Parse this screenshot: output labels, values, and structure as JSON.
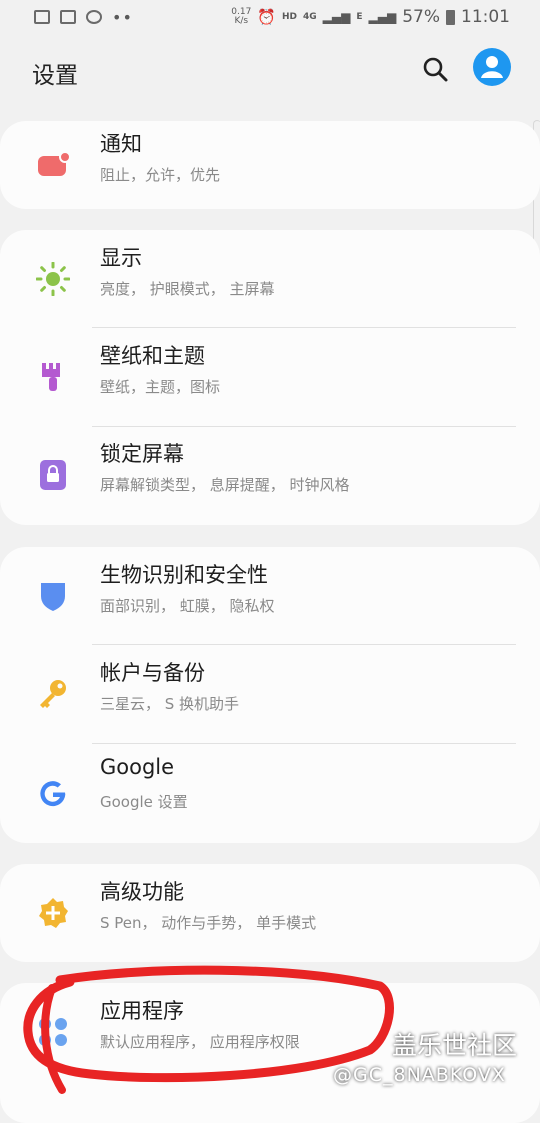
{
  "status_bar": {
    "net_speed_value": "0.17",
    "net_speed_unit": "K/s",
    "hd": "HD",
    "net_4g": "4G",
    "net_e": "E",
    "battery": "57%",
    "time": "11:01"
  },
  "header": {
    "title": "设置"
  },
  "groups": [
    {
      "items": [
        {
          "label": "通知",
          "sub": "阻止，允许，优先",
          "icon": "notification-icon",
          "color": "#ef6b6b"
        }
      ]
    },
    {
      "items": [
        {
          "label": "显示",
          "sub": "亮度， 护眼模式， 主屏幕",
          "icon": "sun-icon",
          "color": "#8cc34a"
        },
        {
          "label": "壁纸和主题",
          "sub": "壁纸，主题，图标",
          "icon": "paintbrush-icon",
          "color": "#b45ad0"
        },
        {
          "label": "锁定屏幕",
          "sub": "屏幕解锁类型， 息屏提醒， 时钟风格",
          "icon": "lock-icon",
          "color": "#9c6fde"
        }
      ]
    },
    {
      "items": [
        {
          "label": "生物识别和安全性",
          "sub": "面部识别， 虹膜， 隐私权",
          "icon": "shield-icon",
          "color": "#5a8ef0"
        },
        {
          "label": "帐户与备份",
          "sub": "三星云， S 换机助手",
          "icon": "key-icon",
          "color": "#f2b531"
        },
        {
          "label": "Google",
          "sub": "Google 设置",
          "icon": "google-icon",
          "color": "#4285f4"
        }
      ]
    },
    {
      "items": [
        {
          "label": "高级功能",
          "sub": "S Pen， 动作与手势， 单手模式",
          "icon": "gear-plus-icon",
          "color": "#f2b531"
        }
      ]
    },
    {
      "items": [
        {
          "label": "应用程序",
          "sub": "默认应用程序， 应用程序权限",
          "icon": "apps-icon",
          "color": "#6aa3ef"
        }
      ]
    }
  ],
  "watermark": {
    "site": "盖乐世社区",
    "user": "@GC_8NABKOVX"
  },
  "colors": {
    "accent": "#1e97f0",
    "annotation": "#e82424"
  }
}
